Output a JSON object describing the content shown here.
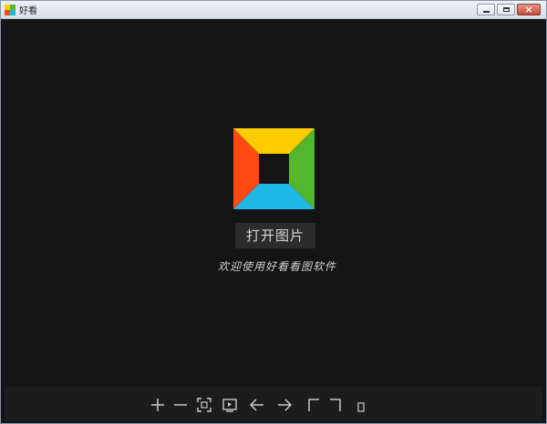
{
  "window": {
    "title": "好看"
  },
  "controls": {
    "close_glyph": "×"
  },
  "main": {
    "open_label": "打开图片",
    "welcome_text": "欢迎使用好看看图软件"
  },
  "toolbar": {
    "items": [
      "zoom-in",
      "zoom-out",
      "fit-window",
      "slideshow",
      "previous",
      "next",
      "rotate-left",
      "rotate-right",
      "delete"
    ]
  },
  "colors": {
    "logo_top": "#ffcc00",
    "logo_right": "#54b72b",
    "logo_bottom": "#1fb7e6",
    "logo_left": "#ff4a12",
    "background": "#141414",
    "toolbar": "#1c1c1c",
    "icon": "#c8c8c8"
  }
}
